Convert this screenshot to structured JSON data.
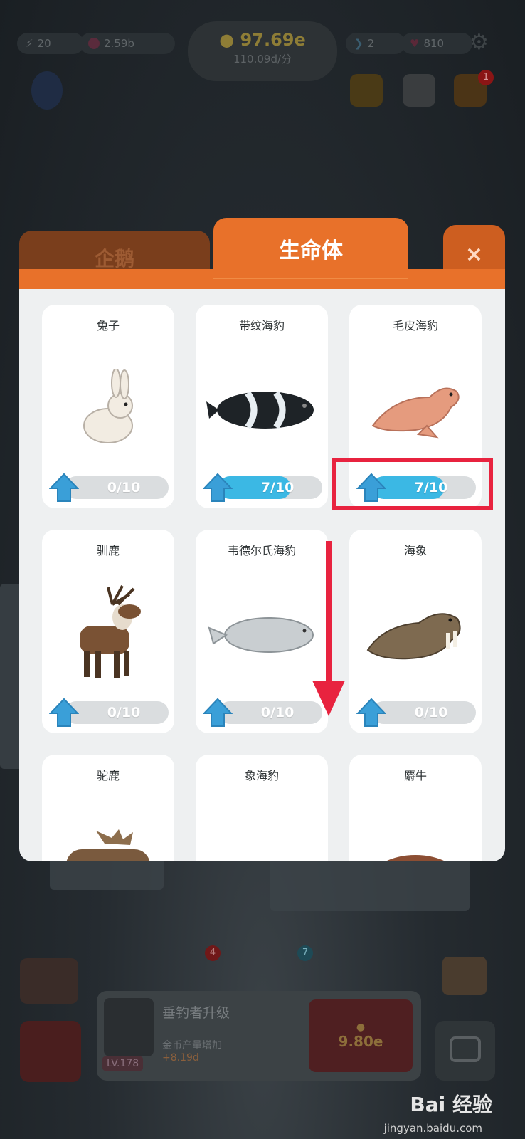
{
  "hud": {
    "left_stat_1": "20",
    "left_stat_2": "2.59b",
    "coins_main": "97.69e",
    "coins_rate": "110.09d/分",
    "fish_count": "2",
    "hearts": "810",
    "notification_badge": "1"
  },
  "tabs": [
    {
      "label": "企鹅",
      "active": false
    },
    {
      "label": "生命体",
      "active": true
    }
  ],
  "close_label": "×",
  "cards": [
    {
      "name": "兔子",
      "progress_text": "0/10",
      "progress": 0.0,
      "icon": "rabbit-icon"
    },
    {
      "name": "带纹海豹",
      "progress_text": "7/10",
      "progress": 0.7,
      "icon": "ribbon-seal-icon"
    },
    {
      "name": "毛皮海豹",
      "progress_text": "7/10",
      "progress": 0.7,
      "icon": "fur-seal-icon"
    },
    {
      "name": "驯鹿",
      "progress_text": "0/10",
      "progress": 0.0,
      "icon": "reindeer-icon"
    },
    {
      "name": "韦德尔氏海豹",
      "progress_text": "0/10",
      "progress": 0.0,
      "icon": "weddell-seal-icon"
    },
    {
      "name": "海象",
      "progress_text": "0/10",
      "progress": 0.0,
      "icon": "walrus-icon"
    },
    {
      "name": "驼鹿",
      "progress_text": "",
      "progress": 0.0,
      "icon": "moose-icon"
    },
    {
      "name": "象海豹",
      "progress_text": "",
      "progress": 0.0,
      "icon": "elephant-seal-icon"
    },
    {
      "name": "麝牛",
      "progress_text": "",
      "progress": 0.0,
      "icon": "musk-ox-icon"
    }
  ],
  "bottom": {
    "badge_left": "4",
    "badge_right": "7",
    "title": "垂钓者升级",
    "subtitle": "金币产量增加",
    "increase": "+8.19d",
    "level": "LV.178",
    "cost": "9.80e"
  },
  "watermark": {
    "brand": "Bai 经验",
    "url": "jingyan.baidu.com"
  },
  "colors": {
    "tab_active": "#e8712a",
    "progress_fill": "#3bb8e4",
    "highlight": "#e8233f"
  }
}
